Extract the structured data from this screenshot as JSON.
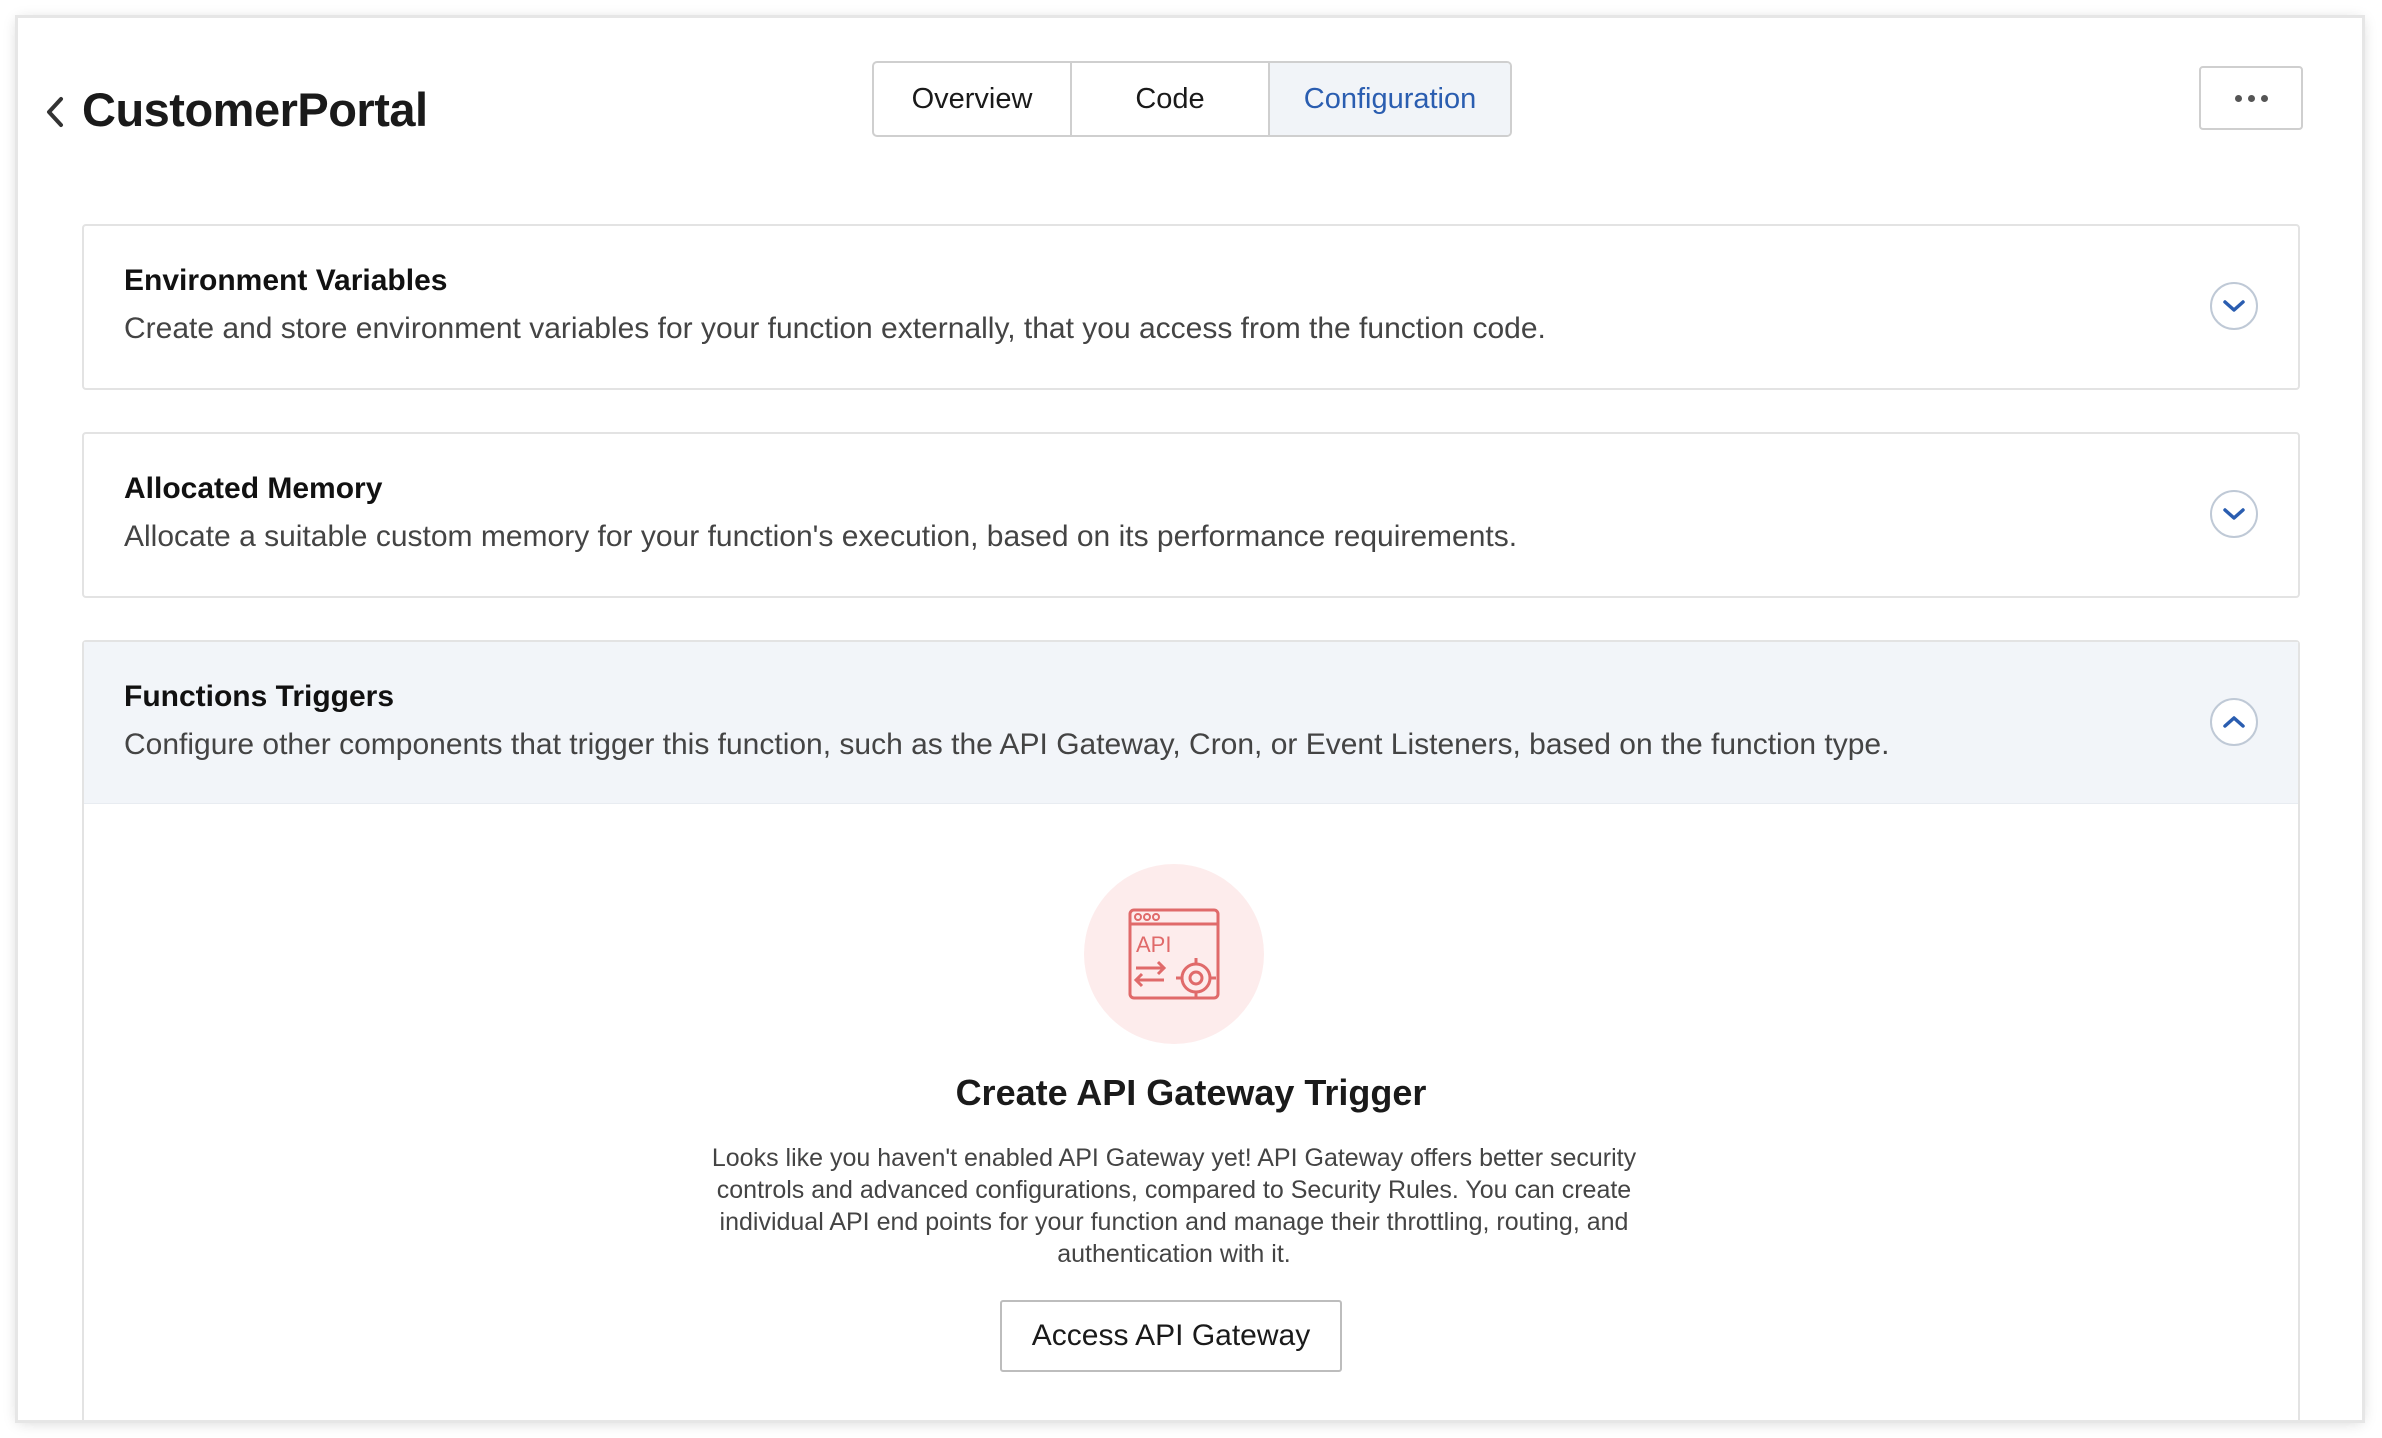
{
  "header": {
    "title": "CustomerPortal",
    "tabs": [
      {
        "label": "Overview"
      },
      {
        "label": "Code"
      },
      {
        "label": "Configuration"
      }
    ]
  },
  "sections": [
    {
      "title": "Environment Variables",
      "description": "Create and store environment variables for your function externally, that you access from the function code."
    },
    {
      "title": "Allocated Memory",
      "description": "Allocate a suitable custom memory for your function's execution, based on its performance requirements."
    },
    {
      "title": "Functions Triggers",
      "description": "Configure other components that trigger this function, such as the API Gateway, Cron, or Event Listeners, based on the function type."
    }
  ],
  "empty_state": {
    "icon_text": "API",
    "title": "Create API Gateway Trigger",
    "description": "Looks like you haven't enabled API Gateway yet! API Gateway offers better security controls and advanced configurations, compared to Security Rules. You can create individual API end points for your function and manage their throttling, routing, and authentication with it.",
    "button_label": "Access API Gateway"
  },
  "colors": {
    "accent": "#2a5db0",
    "active_tab_bg": "#f1f4f8",
    "icon_red": "#e06a6a",
    "icon_bg": "#fdecec"
  },
  "icons": {
    "back": "chevron-left-icon",
    "more": "more-horizontal-icon",
    "expand": "chevron-down-icon",
    "collapse": "chevron-up-icon",
    "api": "api-gateway-icon"
  }
}
